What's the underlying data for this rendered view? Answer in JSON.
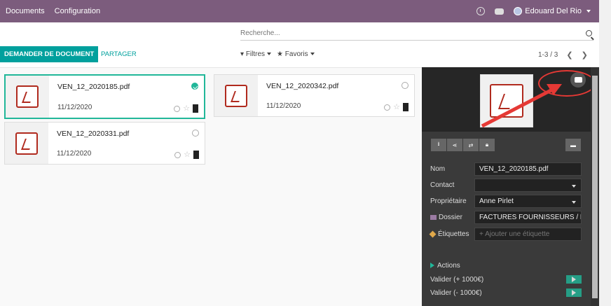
{
  "navbar": {
    "menu": [
      "Documents",
      "Configuration"
    ],
    "user_name": "Edouard Del Rio",
    "icons": [
      "clock-icon",
      "chat-icon"
    ]
  },
  "control_panel": {
    "search_placeholder": "Recherche...",
    "primary_button": "DEMANDER DE DOCUMENT",
    "share_link": "PARTAGER",
    "filters_label": "Filtres",
    "favorites_label": "Favoris",
    "pager": "1-3 / 3"
  },
  "documents": [
    {
      "name": "VEN_12_2020185.pdf",
      "date": "11/12/2020",
      "selected": true
    },
    {
      "name": "VEN_12_2020342.pdf",
      "date": "11/12/2020",
      "selected": false
    },
    {
      "name": "VEN_12_2020331.pdf",
      "date": "11/12/2020",
      "selected": false
    }
  ],
  "inspector": {
    "fields": {
      "name_label": "Nom",
      "name_value": "VEN_12_2020185.pdf",
      "contact_label": "Contact",
      "contact_value": "",
      "owner_label": "Propriétaire",
      "owner_value": "Anne Pirlet",
      "folder_label": "Dossier",
      "folder_value": "FACTURES FOURNISSEURS / FA",
      "tags_label": "Étiquettes",
      "tags_placeholder": "+ Ajouter une étiquette"
    },
    "actions_title": "Actions",
    "actions": [
      "Valider (+ 1000€)",
      "Valider (- 1000€)"
    ],
    "toolbar_icons": [
      "download-icon",
      "share-icon",
      "replace-icon",
      "lock-icon",
      "archive-icon"
    ],
    "accent_color": "#21b799",
    "annotation_color": "#e53935"
  }
}
